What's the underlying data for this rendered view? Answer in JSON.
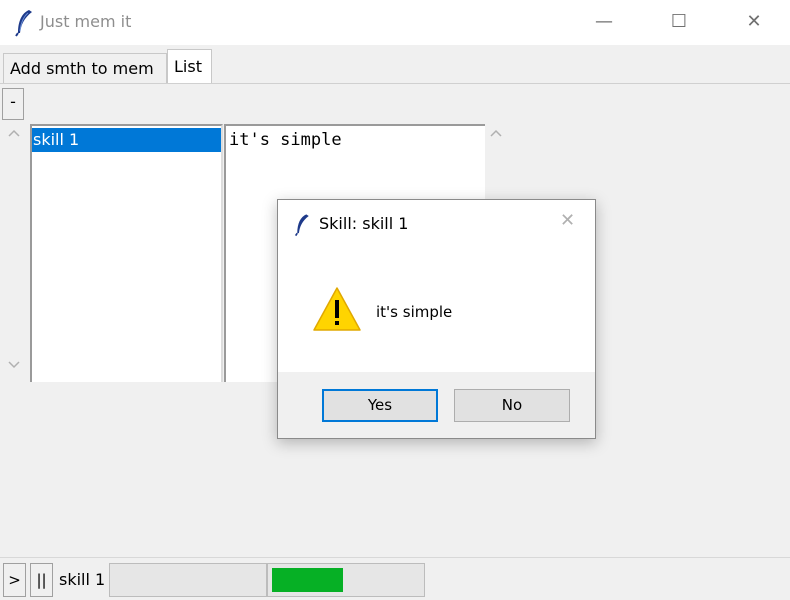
{
  "window": {
    "title": "Just mem it",
    "minimize_glyph": "—",
    "maximize_glyph": "☐",
    "close_glyph": "✕"
  },
  "tabs": [
    {
      "label": "Add smth to mem",
      "active": false
    },
    {
      "label": "List",
      "active": true
    }
  ],
  "toolbar": {
    "remove_label": "-"
  },
  "skills_list": {
    "items": [
      "skill 1"
    ],
    "selected": "skill 1"
  },
  "text_area": {
    "content": "it's simple"
  },
  "dialog": {
    "title": "Skill: skill 1",
    "message": "it's simple",
    "icon": "warning-icon",
    "yes_label": "Yes",
    "no_label": "No",
    "close_glyph": "✕"
  },
  "player": {
    "play_label": ">",
    "pause_label": "||",
    "current_skill": "skill 1",
    "progress_fraction": 0.48,
    "progress_color": "#06b025"
  },
  "colors": {
    "selection": "#0078d7",
    "accent": "#0078d7"
  }
}
